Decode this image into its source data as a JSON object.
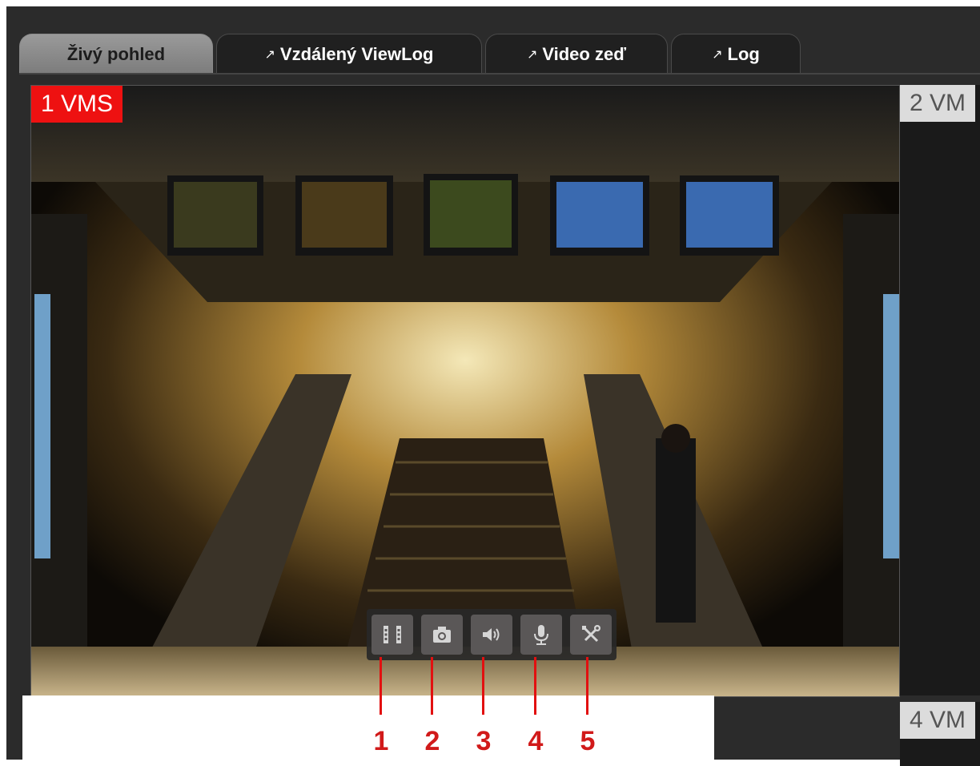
{
  "tabs": [
    {
      "label": "Živý pohled",
      "active": true,
      "external": false
    },
    {
      "label": "Vzdálený ViewLog",
      "active": false,
      "external": true,
      "icon": "external-link-icon"
    },
    {
      "label": "Video zeď",
      "active": false,
      "external": true,
      "icon": "external-link-icon"
    },
    {
      "label": "Log",
      "active": false,
      "external": true,
      "icon": "external-link-icon"
    }
  ],
  "tiles": {
    "tile1": {
      "label": "1 VMS",
      "label_color": "#ee1111"
    },
    "tile2": {
      "label": "2 VM"
    },
    "tile4": {
      "label": "4 VM"
    }
  },
  "toolbar": [
    {
      "icon": "film-icon",
      "callout": "1"
    },
    {
      "icon": "camera-icon",
      "callout": "2"
    },
    {
      "icon": "speaker-icon",
      "callout": "3"
    },
    {
      "icon": "microphone-icon",
      "callout": "4"
    },
    {
      "icon": "tools-icon",
      "callout": "5"
    }
  ],
  "colors": {
    "annotation": "#e21010",
    "accent_label": "#ee1111"
  }
}
